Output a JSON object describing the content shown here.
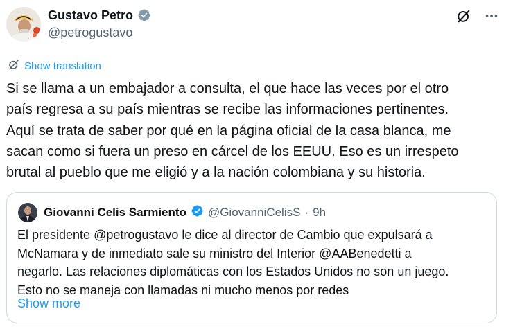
{
  "tweet": {
    "display_name": "Gustavo Petro",
    "handle": "@petrogustavo",
    "translation_label": "Show translation",
    "text_lines": [
      "Si se llama a un embajador a consulta, el que hace las veces por el otro",
      "país regresa a su país mientras se recibe las informaciones pertinentes.",
      "Aquí se trata de saber por qué en la página oficial de la casa blanca, me",
      "sacan como si fuera un preso en cárcel de los EEUU. Eso es un irrespeto",
      "brutal al pueblo que me eligió y a la nación colombiana y su historia."
    ]
  },
  "quote": {
    "display_name": "Giovanni Celis Sarmiento",
    "handle": "@GiovanniCelisS",
    "separator": "·",
    "time": "9h",
    "text_lines": [
      "El presidente @petrogustavo le dice al director de Cambio que expulsará a",
      "McNamara y de inmediato sale su ministro del Interior @AABenedetti a",
      "negarlo. Las relaciones diplomáticas con los Estados Unidos no son un juego.",
      "Esto no se maneja con llamadas ni mucho menos por redes"
    ],
    "show_more_label": "Show more"
  },
  "icons": {
    "verified": "verified-badge-icon",
    "grok": "grok-icon",
    "more": "more-options-icon",
    "translate": "translate-icon"
  },
  "colors": {
    "accent": "#1d9bf0",
    "text": "#0f1419",
    "secondary": "#536471",
    "border": "#cfd9de"
  }
}
